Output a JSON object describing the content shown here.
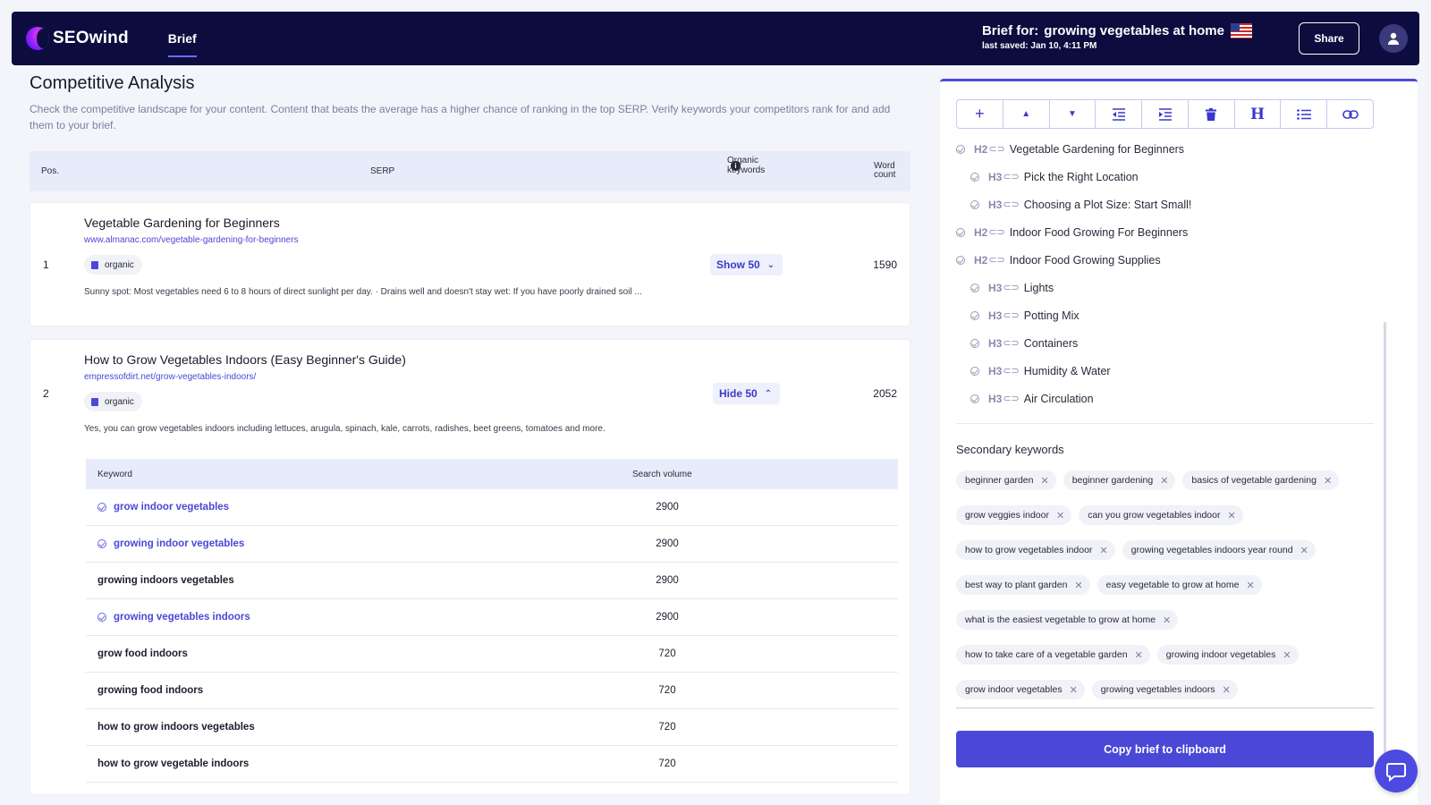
{
  "header": {
    "logo_text": "SEOwind",
    "nav_brief": "Brief",
    "brief_for_label": "Brief for:",
    "brief_topic": "growing vegetables at home",
    "last_saved": "last saved: Jan 10, 4:11 PM",
    "share_label": "Share"
  },
  "competitive": {
    "title": "Competitive Analysis",
    "description": "Check the competitive landscape for your content. Content that beats the average has a higher chance of ranking in the top SERP. Verify keywords your competitors rank for and add them to your brief.",
    "columns": {
      "pos": "Pos.",
      "serp": "SERP",
      "organic": "Organic keywords",
      "word_count_1": "Word",
      "word_count_2": "count"
    },
    "results": [
      {
        "pos": "1",
        "title": "Vegetable Gardening for Beginners",
        "url": "www.almanac.com/vegetable-gardening-for-beginners",
        "badge": "organic",
        "snippet": "Sunny spot: Most vegetables need 6 to 8 hours of direct sunlight per day. · Drains well and doesn't stay wet: If you have poorly drained soil ...",
        "toggle": "Show 50",
        "word_count": "1590"
      },
      {
        "pos": "2",
        "title": "How to Grow Vegetables Indoors (Easy Beginner's Guide)",
        "url": "empressofdirt.net/grow-vegetables-indoors/",
        "badge": "organic",
        "snippet": "Yes, you can grow vegetables indoors including lettuces, arugula, spinach, kale, carrots, radishes, beet greens, tomatoes and more.",
        "toggle": "Hide 50",
        "word_count": "2052"
      }
    ],
    "kw_columns": {
      "keyword": "Keyword",
      "volume": "Search volume"
    },
    "keywords": [
      {
        "name": "grow indoor vegetables",
        "volume": "2900",
        "linked": true
      },
      {
        "name": "growing indoor vegetables",
        "volume": "2900",
        "linked": true
      },
      {
        "name": "growing indoors vegetables",
        "volume": "2900",
        "linked": false
      },
      {
        "name": "growing vegetables indoors",
        "volume": "2900",
        "linked": true
      },
      {
        "name": "grow food indoors",
        "volume": "720",
        "linked": false
      },
      {
        "name": "growing food indoors",
        "volume": "720",
        "linked": false
      },
      {
        "name": "how to grow indoors vegetables",
        "volume": "720",
        "linked": false
      },
      {
        "name": "how to grow vegetable indoors",
        "volume": "720",
        "linked": false
      }
    ]
  },
  "outline": [
    {
      "level": "H2",
      "text": "Vegetable Gardening for Beginners"
    },
    {
      "level": "H3",
      "text": "Pick the Right Location"
    },
    {
      "level": "H3",
      "text": "Choosing a Plot Size: Start Small!"
    },
    {
      "level": "H2",
      "text": "Indoor Food Growing For Beginners"
    },
    {
      "level": "H2",
      "text": "Indoor Food Growing Supplies"
    },
    {
      "level": "H3",
      "text": "Lights"
    },
    {
      "level": "H3",
      "text": "Potting Mix"
    },
    {
      "level": "H3",
      "text": "Containers"
    },
    {
      "level": "H3",
      "text": "Humidity & Water"
    },
    {
      "level": "H3",
      "text": "Air Circulation"
    }
  ],
  "secondary": {
    "title": "Secondary keywords",
    "chips": [
      "beginner garden",
      "beginner gardening",
      "basics of vegetable gardening",
      "grow veggies indoor",
      "can you grow vegetables indoor",
      "how to grow vegetables indoor",
      "growing vegetables indoors year round",
      "best way to plant garden",
      "easy vegetable to grow at home",
      "what is the easiest vegetable to grow at home",
      "how to take care of a vegetable garden",
      "growing indoor vegetables",
      "grow indoor vegetables",
      "growing vegetables indoors"
    ]
  },
  "copy_label": "Copy brief to clipboard",
  "colors": {
    "navbar": "#0c0c3f",
    "accent": "#4a48d6",
    "panel_border": "#4c4ae0"
  }
}
